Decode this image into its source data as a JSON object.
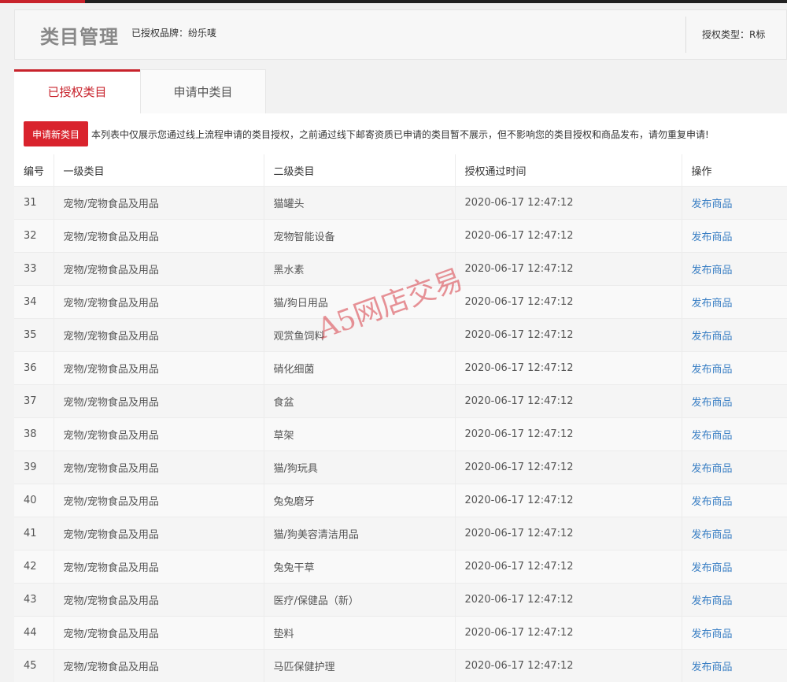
{
  "header": {
    "title": "类目管理",
    "brand_text": "已授权品牌：纷乐唛",
    "auth_type_text": "授权类型：R标"
  },
  "tabs": [
    {
      "label": "已授权类目",
      "active": true
    },
    {
      "label": "申请中类目",
      "active": false
    }
  ],
  "notice": {
    "button_label": "申请新类目",
    "text": "本列表中仅展示您通过线上流程申请的类目授权，之前通过线下邮寄资质已申请的类目暂不展示，但不影响您的类目授权和商品发布，请勿重复申请!"
  },
  "table": {
    "columns": [
      "编号",
      "一级类目",
      "二级类目",
      "授权通过时间",
      "操作"
    ],
    "rows": [
      {
        "id": "31",
        "level1": "宠物/宠物食品及用品",
        "level2": "猫罐头",
        "time": "2020-06-17 12:47:12",
        "action": "发布商品"
      },
      {
        "id": "32",
        "level1": "宠物/宠物食品及用品",
        "level2": "宠物智能设备",
        "time": "2020-06-17 12:47:12",
        "action": "发布商品"
      },
      {
        "id": "33",
        "level1": "宠物/宠物食品及用品",
        "level2": "黑水素",
        "time": "2020-06-17 12:47:12",
        "action": "发布商品"
      },
      {
        "id": "34",
        "level1": "宠物/宠物食品及用品",
        "level2": "猫/狗日用品",
        "time": "2020-06-17 12:47:12",
        "action": "发布商品"
      },
      {
        "id": "35",
        "level1": "宠物/宠物食品及用品",
        "level2": "观赏鱼饲料",
        "time": "2020-06-17 12:47:12",
        "action": "发布商品"
      },
      {
        "id": "36",
        "level1": "宠物/宠物食品及用品",
        "level2": "硝化细菌",
        "time": "2020-06-17 12:47:12",
        "action": "发布商品"
      },
      {
        "id": "37",
        "level1": "宠物/宠物食品及用品",
        "level2": "食盆",
        "time": "2020-06-17 12:47:12",
        "action": "发布商品"
      },
      {
        "id": "38",
        "level1": "宠物/宠物食品及用品",
        "level2": "草架",
        "time": "2020-06-17 12:47:12",
        "action": "发布商品"
      },
      {
        "id": "39",
        "level1": "宠物/宠物食品及用品",
        "level2": "猫/狗玩具",
        "time": "2020-06-17 12:47:12",
        "action": "发布商品"
      },
      {
        "id": "40",
        "level1": "宠物/宠物食品及用品",
        "level2": "兔兔磨牙",
        "time": "2020-06-17 12:47:12",
        "action": "发布商品"
      },
      {
        "id": "41",
        "level1": "宠物/宠物食品及用品",
        "level2": "猫/狗美容清洁用品",
        "time": "2020-06-17 12:47:12",
        "action": "发布商品"
      },
      {
        "id": "42",
        "level1": "宠物/宠物食品及用品",
        "level2": "兔兔干草",
        "time": "2020-06-17 12:47:12",
        "action": "发布商品"
      },
      {
        "id": "43",
        "level1": "宠物/宠物食品及用品",
        "level2": "医疗/保健品（新）",
        "time": "2020-06-17 12:47:12",
        "action": "发布商品"
      },
      {
        "id": "44",
        "level1": "宠物/宠物食品及用品",
        "level2": "垫料",
        "time": "2020-06-17 12:47:12",
        "action": "发布商品"
      },
      {
        "id": "45",
        "level1": "宠物/宠物食品及用品",
        "level2": "马匹保健护理",
        "time": "2020-06-17 12:47:12",
        "action": "发布商品"
      }
    ]
  },
  "watermark": "A5网店交易",
  "colors": {
    "accent_red": "#c8232c",
    "button_red": "#d9232d",
    "link_blue": "#3a7fc4"
  }
}
